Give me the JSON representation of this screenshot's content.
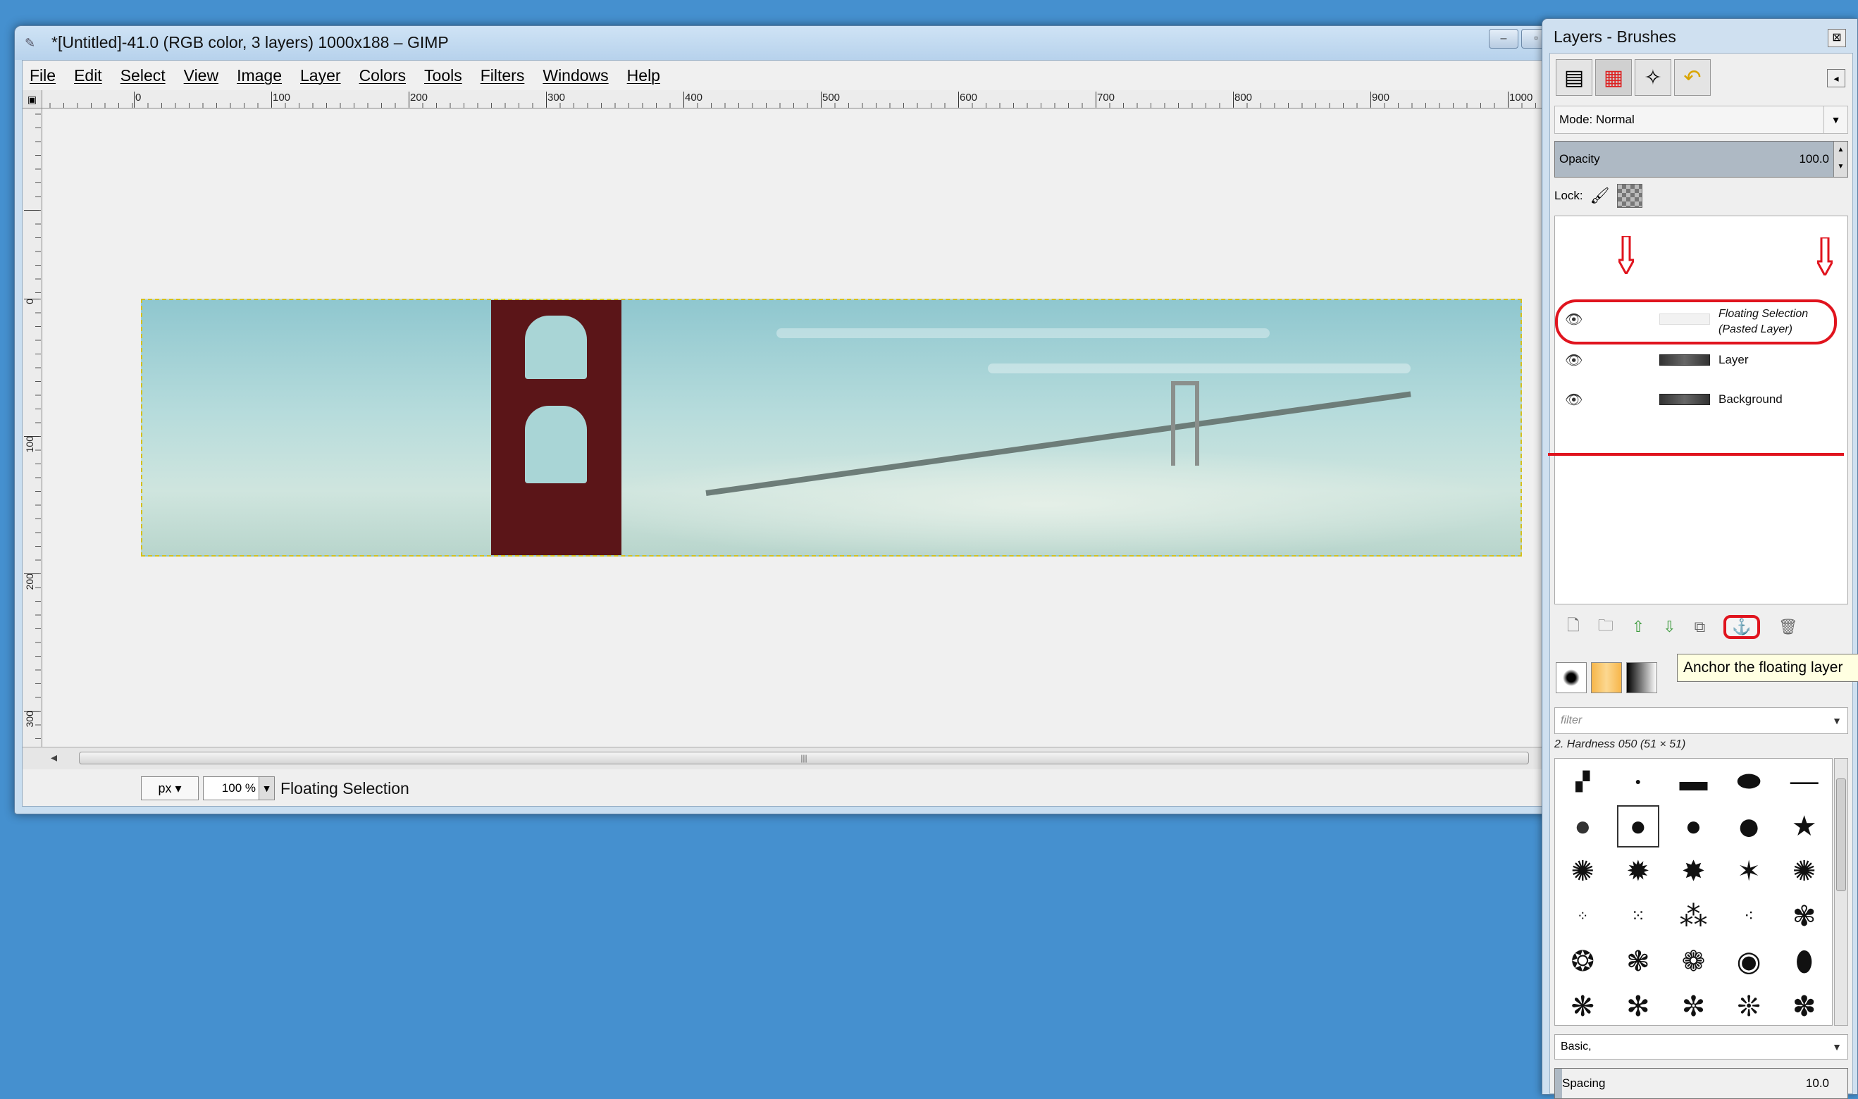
{
  "window": {
    "title": "*[Untitled]-41.0 (RGB color, 3 layers) 1000x188 – GIMP",
    "app_icon": "gimp-icon",
    "controls": [
      "–",
      "▫",
      "✕"
    ]
  },
  "menu": [
    "File",
    "Edit",
    "Select",
    "View",
    "Image",
    "Layer",
    "Colors",
    "Tools",
    "Filters",
    "Windows",
    "Help"
  ],
  "ruler": {
    "h_ticks": [
      "0",
      "100",
      "200",
      "300",
      "400",
      "500",
      "600",
      "700",
      "800",
      "900",
      "1000"
    ],
    "v_ticks": [
      "0",
      "100",
      "200",
      "300"
    ]
  },
  "statusbar": {
    "unit": "px",
    "zoom": "100 %",
    "message": "Floating Selection"
  },
  "dock": {
    "title": "Layers - Brushes",
    "mode_label": "Mode: Normal",
    "opacity_label": "Opacity",
    "opacity_value": "100.0",
    "lock_label": "Lock:",
    "layers": [
      {
        "name_line1": "Floating Selection",
        "name_line2": "(Pasted Layer)",
        "visible": true
      },
      {
        "name": "Layer",
        "visible": true
      },
      {
        "name": "Background",
        "visible": true
      }
    ],
    "tooltip": "Anchor the floating layer",
    "brush_filter_placeholder": "filter",
    "brush_name": "2. Hardness 050 (51 × 51)",
    "brush_preset": "Basic,",
    "spacing_label": "Spacing",
    "spacing_value": "10.0"
  },
  "colors": {
    "desktop": "#4590cf",
    "annotation": "#e0141e",
    "tooltip_bg": "#ffffe1"
  }
}
